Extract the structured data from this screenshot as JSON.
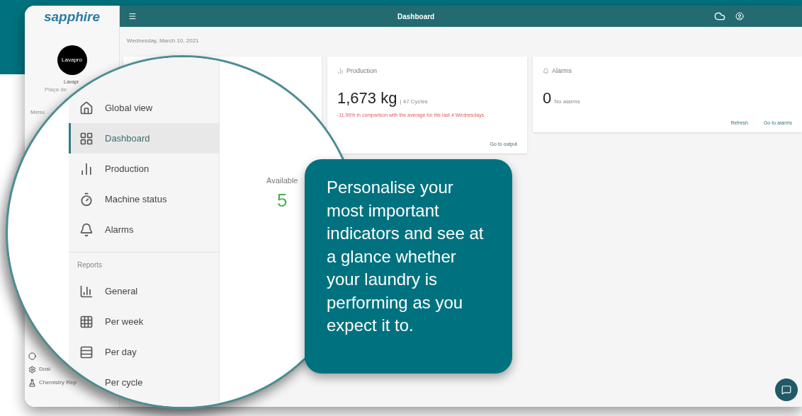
{
  "logo": {
    "text": "sapphire"
  },
  "sidebar": {
    "account_name": "Lavapr",
    "account_address": "Plaça de",
    "avatar_text": "Lavapro",
    "menu_label": "Menu",
    "items": [
      {
        "label": "Dosi",
        "kind": "gear"
      },
      {
        "label": "Chemistry Rep",
        "kind": "flask"
      }
    ]
  },
  "header": {
    "title": "Dashboard"
  },
  "date": "Wednesday, March 10, 2021",
  "cards": [
    {
      "kind": "machines",
      "label": "Available",
      "value": "5"
    },
    {
      "kind": "production",
      "title": "Production",
      "value": "1,673 kg",
      "sub": "| 47 Cycles",
      "note": "-11.90% in comparison with the average for the last 4 Wednesdays",
      "actions": [
        "Go to output"
      ]
    },
    {
      "kind": "alarms",
      "title": "Alarms",
      "value": "0",
      "sub": "No alarms",
      "actions": [
        "Refresh",
        "Go to alarms"
      ]
    }
  ],
  "magnifier": {
    "items": [
      {
        "label": "Global view",
        "selected": false
      },
      {
        "label": "Dashboard",
        "selected": true
      },
      {
        "label": "Production",
        "selected": false
      },
      {
        "label": "Machine status",
        "selected": false
      },
      {
        "label": "Alarms",
        "selected": false
      }
    ],
    "section": "Reports",
    "reports": [
      {
        "label": "General",
        "selected": false
      },
      {
        "label": "Per week",
        "selected": false
      },
      {
        "label": "Per day",
        "selected": false
      },
      {
        "label": "Per cycle",
        "selected": false
      }
    ]
  },
  "callout": "Personalise your most important indicators and see at a glance whether your laundry is performing as you expect it to."
}
